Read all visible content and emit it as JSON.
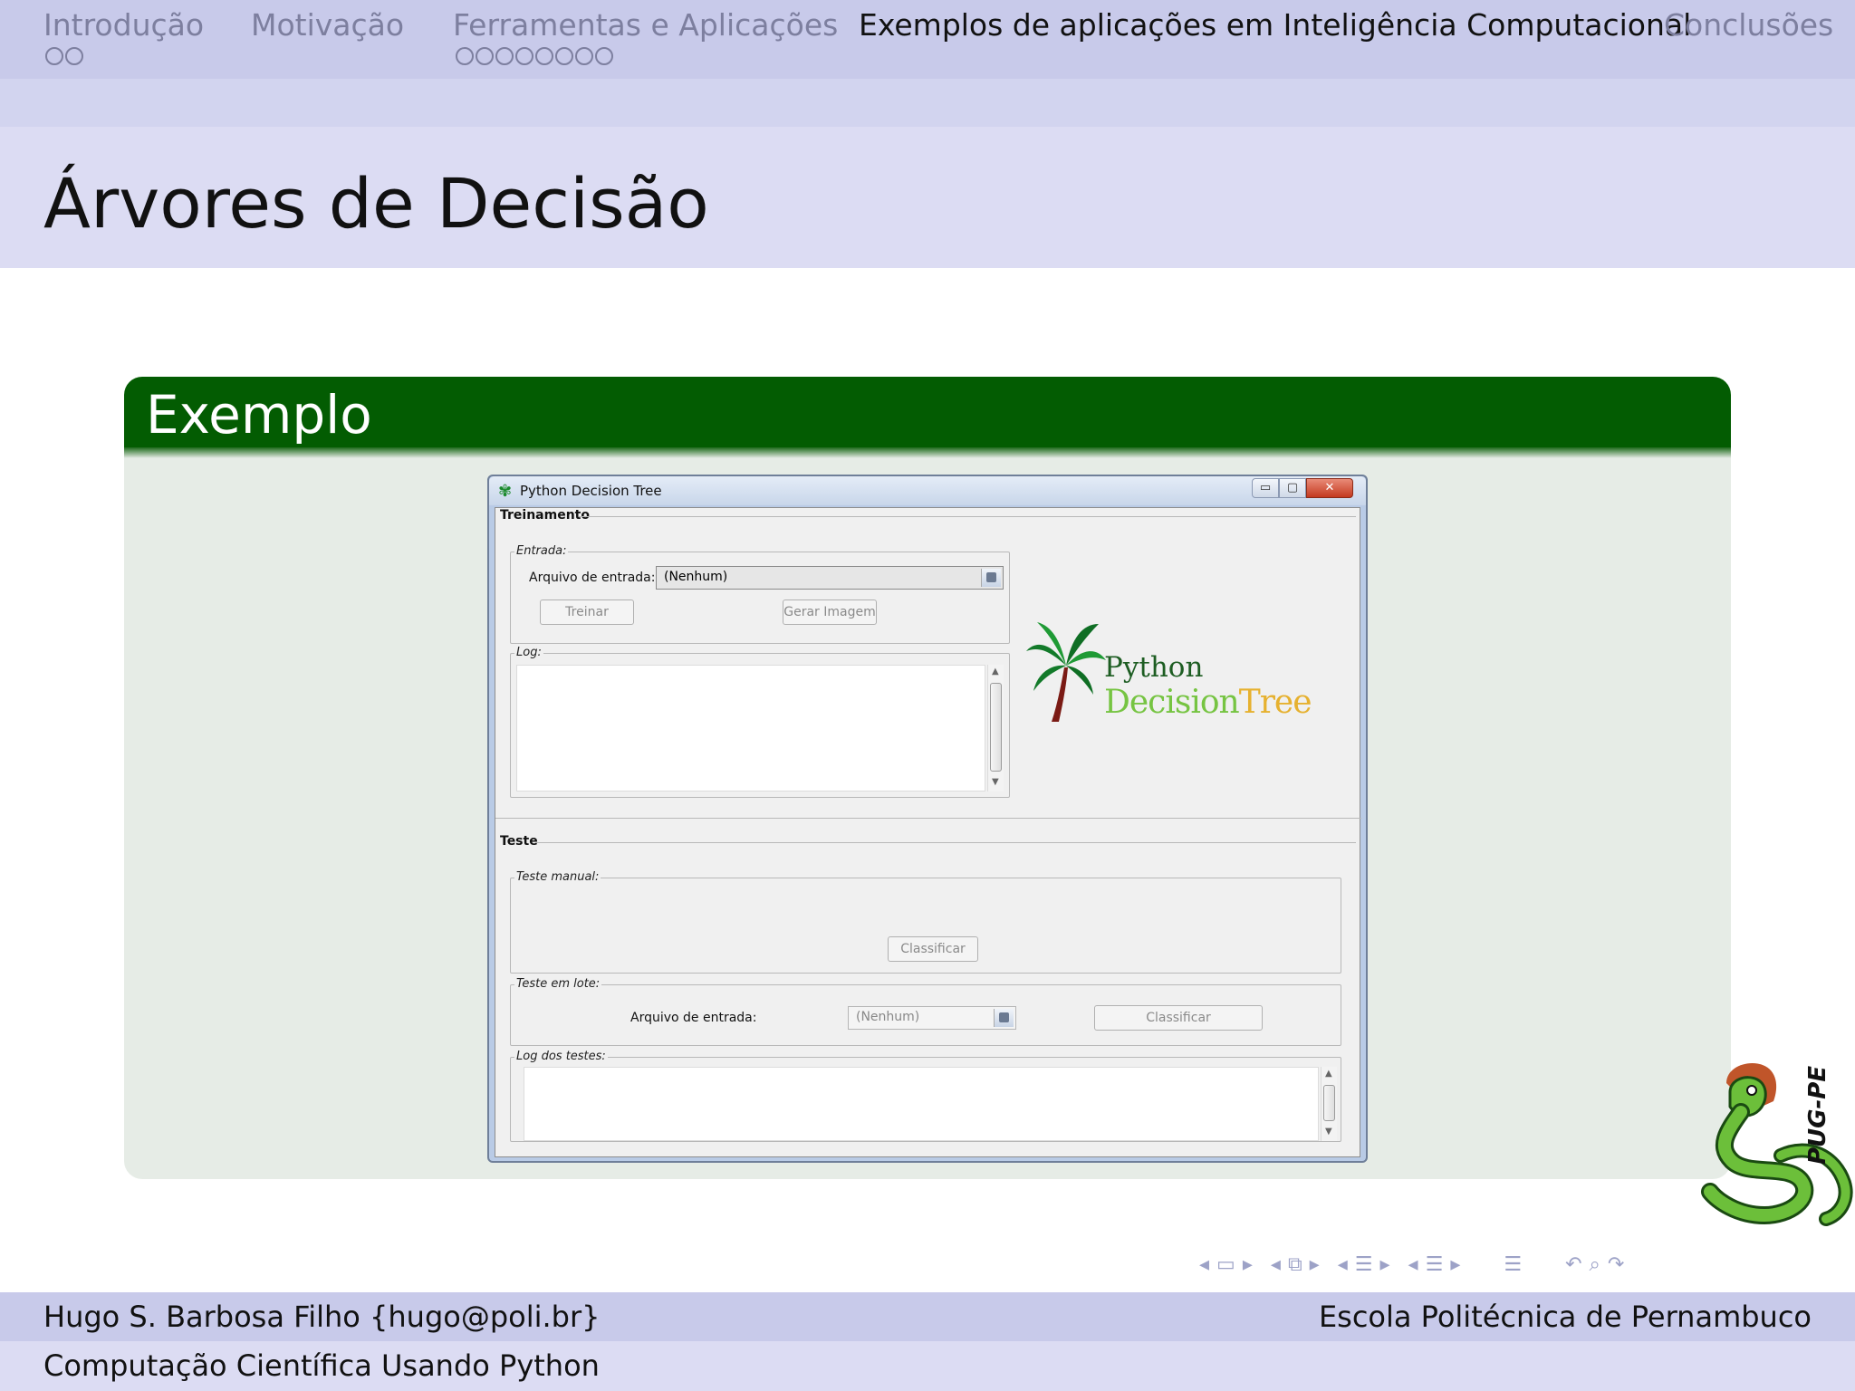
{
  "nav": {
    "sections": [
      {
        "label": "Introdução",
        "dots": 2
      },
      {
        "label": "Motivação",
        "dots": 0
      },
      {
        "label": "Ferramentas e Aplicações",
        "dots": 8
      },
      {
        "label": "Exemplos de aplicações em Inteligência Computacional",
        "dots": 0,
        "active": true
      },
      {
        "label": "Conclusões",
        "dots": 0
      }
    ]
  },
  "frame": {
    "title": "Árvores de Decisão"
  },
  "block": {
    "title": "Exemplo"
  },
  "window": {
    "title": "Python Decision Tree",
    "controls": {
      "minimize": "▭",
      "maximize": "▢",
      "close": "✕"
    },
    "training": {
      "section_label": "Treinamento",
      "input_group_label": "Entrada:",
      "input_file_label": "Arquivo de entrada:",
      "input_file_value": "(Nenhum)",
      "train_button": "Treinar",
      "image_button": "Gerar Imagem",
      "log_group_label": "Log:"
    },
    "logo": {
      "python": "Python",
      "decision": "Decision",
      "tree": "Tree"
    },
    "test": {
      "section_label": "Teste",
      "manual_group_label": "Teste manual:",
      "manual_classify_button": "Classificar",
      "batch_group_label": "Teste em lote:",
      "batch_file_label": "Arquivo de entrada:",
      "batch_file_value": "(Nenhum)",
      "batch_classify_button": "Classificar",
      "log_group_label": "Log dos testes:"
    }
  },
  "mascot": {
    "label": "PUG-PE"
  },
  "footer": {
    "author": "Hugo S. Barbosa Filho {hugo@poli.br}",
    "institution": "Escola Politécnica de Pernambuco",
    "talk_title": "Computação Científica Usando Python"
  },
  "colors": {
    "nav_bg": "#c8caea",
    "title_bg": "#dcdcf3",
    "block_head": "#035c02",
    "block_body": "#e6ece6"
  }
}
